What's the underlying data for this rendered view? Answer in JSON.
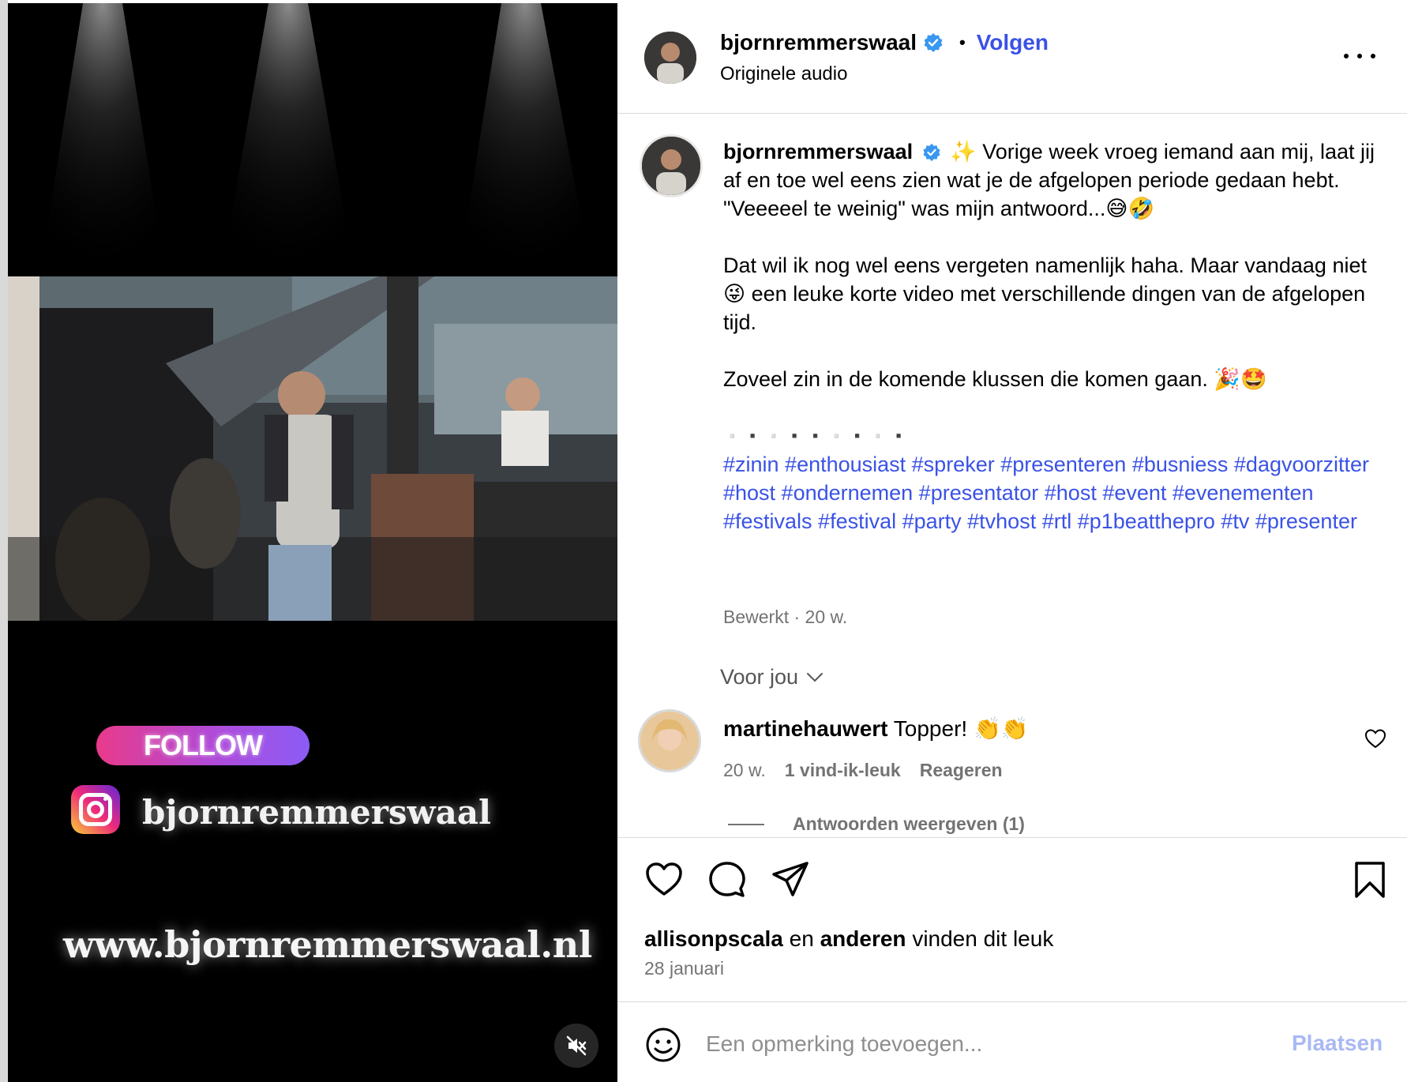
{
  "header": {
    "username": "bjornremmerswaal",
    "follow_label": "Volgen",
    "separator": "•",
    "audio": "Originele audio"
  },
  "video": {
    "follow_badge": "FOLLOW",
    "handle": "bjornremmerswaal",
    "url": "www.bjornremmerswaal.nl",
    "mute_icon": "speaker-muted-icon"
  },
  "caption": {
    "username": "bjornremmerswaal",
    "line1": "✨ Vorige week vroeg iemand aan mij, laat jij af en toe wel eens zien wat je de afgelopen periode gedaan hebt.",
    "line2": "\"Veeeeel te weinig\" was mijn antwoord...😅🤣",
    "line3": "Dat wil ik nog wel eens vergeten namenlijk haha. Maar vandaag niet 😜 een leuke korte video met verschillende dingen van de afgelopen tijd.",
    "line4": "Zoveel zin in de komende klussen die komen gaan. 🎉🤩",
    "squares": "▫️▪️▫️▪️▪️▫️▪️▫️▪️",
    "hashtags": "#zinin #enthousiast #spreker #presenteren #busniess #dagvoorzitter #host #ondernemen #presentator #host #event #evenementen #festivals #festival #party #tvhost #rtl #p1beatthepro #tv #presenter",
    "meta": "Bewerkt · 20 w."
  },
  "for_you": "Voor jou",
  "comment": {
    "username": "martinehauwert",
    "text": "Topper! 👏👏",
    "age": "20 w.",
    "likes": "1 vind-ik-leuk",
    "reply": "Reageren",
    "view_replies": "Antwoorden weergeven (1)"
  },
  "actions": {
    "like_icon": "heart-icon",
    "comment_icon": "comment-icon",
    "share_icon": "send-icon",
    "save_icon": "bookmark-icon",
    "liked_by_user": "allisonpscala",
    "liked_by_and": "en",
    "liked_by_others": "anderen",
    "liked_by_suffix": "vinden dit leuk",
    "date": "28 januari"
  },
  "composer": {
    "placeholder": "Een opmerking toevoegen...",
    "post_label": "Plaatsen"
  },
  "colors": {
    "link_blue": "#3a52e6",
    "post_disabled": "#a9b8f5",
    "verified": "#3897f0",
    "muted_text": "#737373"
  }
}
